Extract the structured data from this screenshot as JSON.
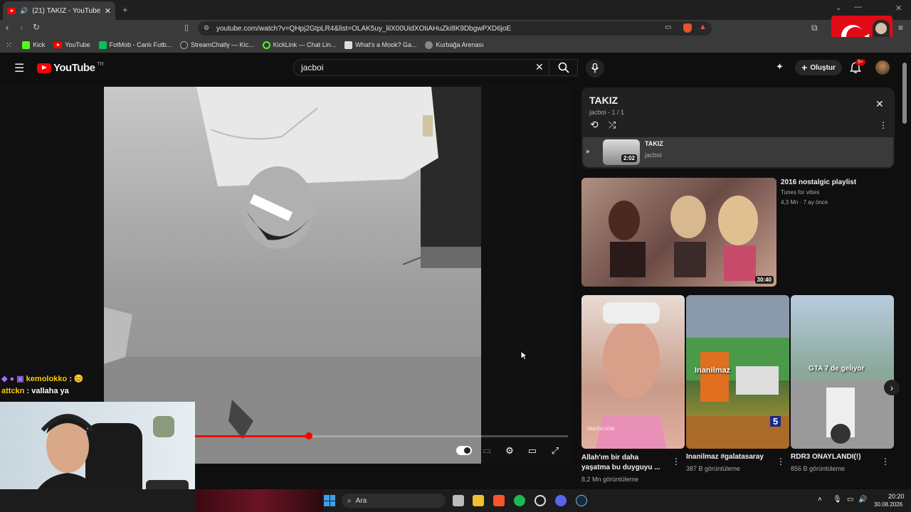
{
  "browser": {
    "tab_title": "(21) TAKIZ - YouTube",
    "url": "youtube.com/watch?v=QHpj2GtpLR4&list=OLAK5uy_lilX00UidXOtiAHuZki8K9DbgwPXD6joE",
    "bookmarks": [
      "Kick",
      "YouTube",
      "FotMob - Canlı Futb...",
      "StreamChatly — Kic...",
      "KickLink — Chat Lin...",
      "What's a Mook? Ga...",
      "Kurbağa Arenası"
    ]
  },
  "youtube": {
    "logo_text": "YouTube",
    "region": "TR",
    "search_value": "jacboi",
    "create_label": "Oluştur",
    "notif_badge": "9+"
  },
  "playlist": {
    "title": "TAKIZ",
    "subtitle": "jacboi - 1 / 1",
    "item": {
      "title": "TAKIZ",
      "channel": "jacboi",
      "duration": "2:02"
    }
  },
  "recommended": {
    "featured": {
      "title": "2016 nostalgic playlist",
      "channel": "Tunes for vibes",
      "meta": "4,3 Mn · 7 ay önce",
      "duration": "30:40"
    },
    "shorts": [
      {
        "title": "Allah'ım bir daha yaşatma bu duyguyu ...",
        "views": "8,2 Mn görüntüleme",
        "tag": "ÖNCEKİ GÜN"
      },
      {
        "title": "Inanilmaz #galatasaray",
        "views": "387 B görüntüleme",
        "overlay": "Inanilmaz",
        "score": "5"
      },
      {
        "title": "RDR3 ONAYLANDI(!)",
        "views": "856 B görüntüleme",
        "overlay": "GTA 7 de geliyor"
      }
    ]
  },
  "chat": [
    {
      "user": "kemolokko",
      "text": "😊"
    },
    {
      "user": "attckn",
      "text": "vallaha ya"
    }
  ],
  "taskbar": {
    "search_label": "Ara",
    "time": "20:20",
    "date": "30.08.2026"
  }
}
